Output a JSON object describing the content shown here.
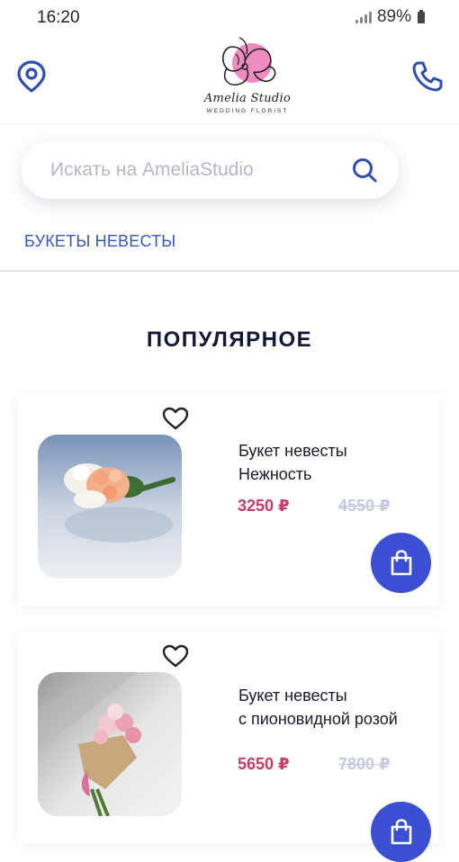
{
  "status_bar": {
    "time": "16:20",
    "battery": "89%"
  },
  "brand": {
    "name": "Amelia Studio",
    "tagline": "WEDDING FLORIST"
  },
  "search": {
    "placeholder": "Искать на AmeliaStudio"
  },
  "category": {
    "label": "БУКЕТЫ НЕВЕСТЫ"
  },
  "section": {
    "title": "ПОПУЛЯРНОЕ"
  },
  "products": [
    {
      "name_line1": "Букет невесты",
      "name_line2": "Нежность",
      "price": "3250 ₽",
      "old_price": "4550 ₽"
    },
    {
      "name_line1": "Букет невесты",
      "name_line2": "с пионовидной розой",
      "price": "5650 ₽",
      "old_price": "7800 ₽"
    }
  ],
  "colors": {
    "accent": "#3a4fd2",
    "link": "#3b56b5",
    "price": "#c93b61",
    "old_price": "#c5c9e0",
    "logo_pink": "#f08bc0"
  },
  "icons": [
    "location-icon",
    "phone-icon",
    "search-icon",
    "heart-icon",
    "shopping-bag-icon"
  ]
}
